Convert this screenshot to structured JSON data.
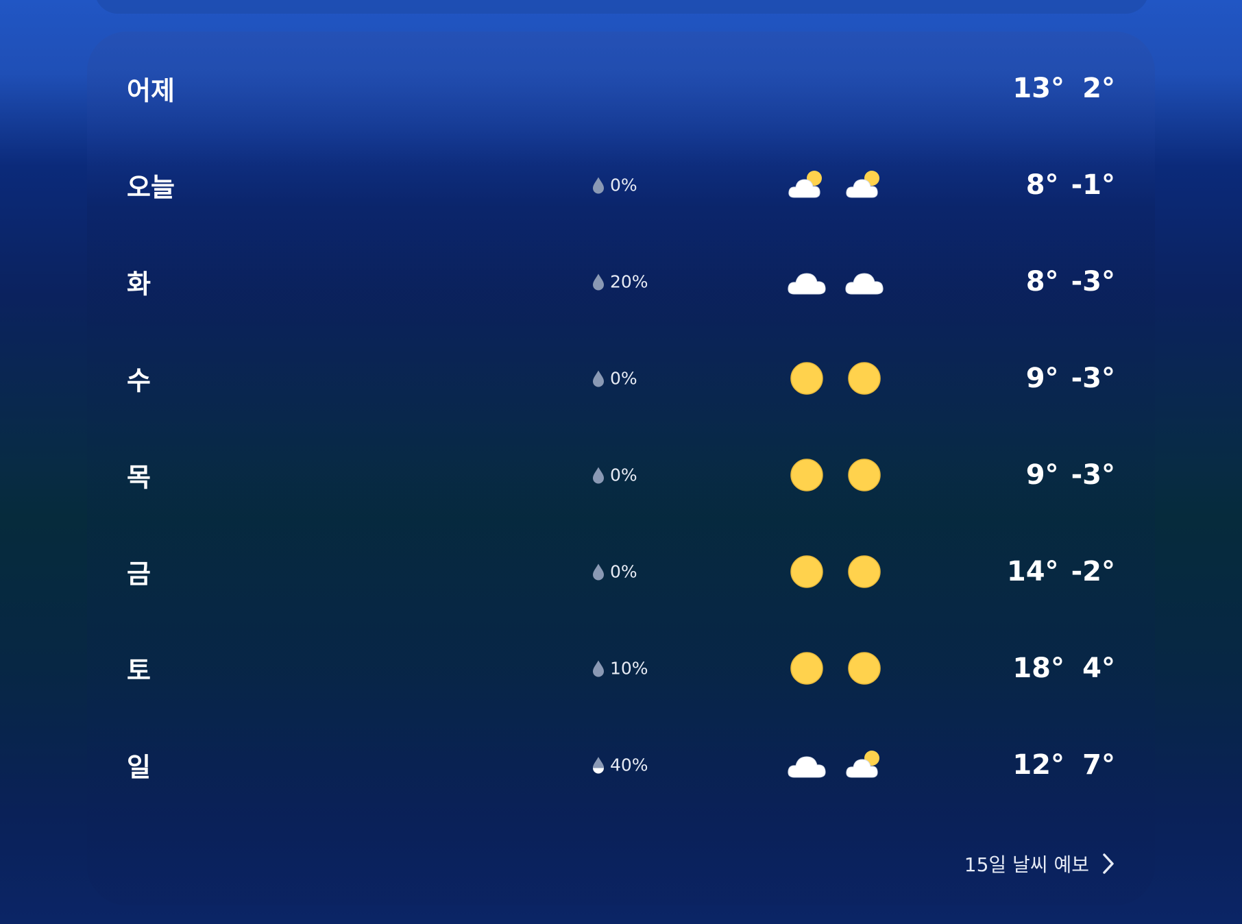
{
  "forecast": {
    "days": [
      {
        "day": "어제",
        "precip": "",
        "am_icon": "",
        "pm_icon": "",
        "high": "13°",
        "low": "2°"
      },
      {
        "day": "오늘",
        "precip": "0%",
        "am_icon": "partly-cloudy-icon",
        "pm_icon": "partly-cloudy-icon",
        "high": "8°",
        "low": "-1°"
      },
      {
        "day": "화",
        "precip": "20%",
        "am_icon": "cloudy-icon",
        "pm_icon": "cloudy-icon",
        "high": "8°",
        "low": "-3°"
      },
      {
        "day": "수",
        "precip": "0%",
        "am_icon": "sunny-icon",
        "pm_icon": "sunny-icon",
        "high": "9°",
        "low": "-3°"
      },
      {
        "day": "목",
        "precip": "0%",
        "am_icon": "sunny-icon",
        "pm_icon": "sunny-icon",
        "high": "9°",
        "low": "-3°"
      },
      {
        "day": "금",
        "precip": "0%",
        "am_icon": "sunny-icon",
        "pm_icon": "sunny-icon",
        "high": "14°",
        "low": "-2°"
      },
      {
        "day": "토",
        "precip": "10%",
        "am_icon": "sunny-icon",
        "pm_icon": "sunny-icon",
        "high": "18°",
        "low": "4°"
      },
      {
        "day": "일",
        "precip": "40%",
        "am_icon": "cloudy-icon",
        "pm_icon": "partly-cloudy-icon",
        "high": "12°",
        "low": "7°"
      }
    ],
    "more_label": "15일 날씨 예보"
  },
  "colors": {
    "sun": "#ffd24d",
    "cloud": "#ffffff",
    "drop": "#8a99b4"
  }
}
